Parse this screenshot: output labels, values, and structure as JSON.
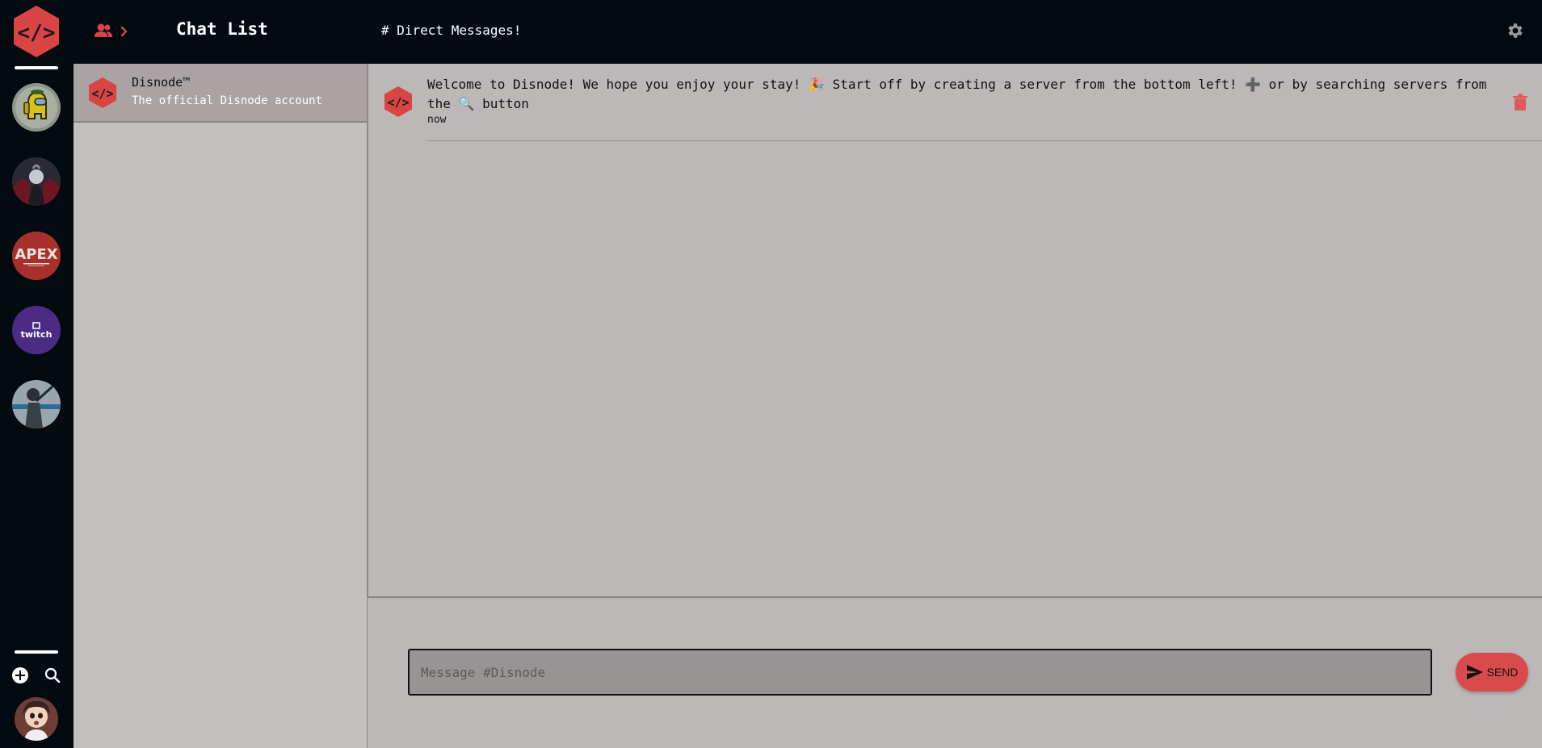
{
  "colors": {
    "brand_red": "#d94545",
    "dark_bg": "#040b10",
    "panel_bg": "#bdb8b8",
    "selected_item": "#a9a3a3"
  },
  "server_rail": {
    "app_logo_icon": "code-brackets-hexagon-icon",
    "servers": [
      {
        "name": "Among Us server",
        "icon": "among-us-icon"
      },
      {
        "name": "Dark art server",
        "icon": "dark-art-icon"
      },
      {
        "name": "Apex Legends server",
        "icon": "apex-legends-icon",
        "logo_text": "APEX"
      },
      {
        "name": "Twitch server",
        "icon": "twitch-icon",
        "logo_text": "twitch"
      },
      {
        "name": "Anime server",
        "icon": "anime-icon"
      }
    ],
    "add_server_icon": "plus-circle-icon",
    "search_servers_icon": "search-icon"
  },
  "chat_list": {
    "title": "Chat List",
    "friends_icon": "people-icon",
    "chevron_icon": "chevron-right-icon",
    "items": [
      {
        "name": "Disnode™",
        "subtitle": "The official Disnode account",
        "selected": true
      }
    ]
  },
  "channel": {
    "title": "# Direct Messages!",
    "settings_icon": "gear-icon"
  },
  "messages": [
    {
      "text_part1": "Welcome to Disnode! We hope you enjoy your stay! ",
      "emoji_party": "🎉",
      "text_part2": " Start off by creating a server from the bottom left! ",
      "emoji_plus": "➕",
      "text_part3": " or by searching servers from the ",
      "emoji_search": "🔍",
      "text_part4": " button",
      "time": "now",
      "delete_icon": "trash-icon"
    }
  ],
  "composer": {
    "placeholder": "Message #Disnode",
    "value": "",
    "send_label": "SEND",
    "send_icon": "send-icon"
  }
}
